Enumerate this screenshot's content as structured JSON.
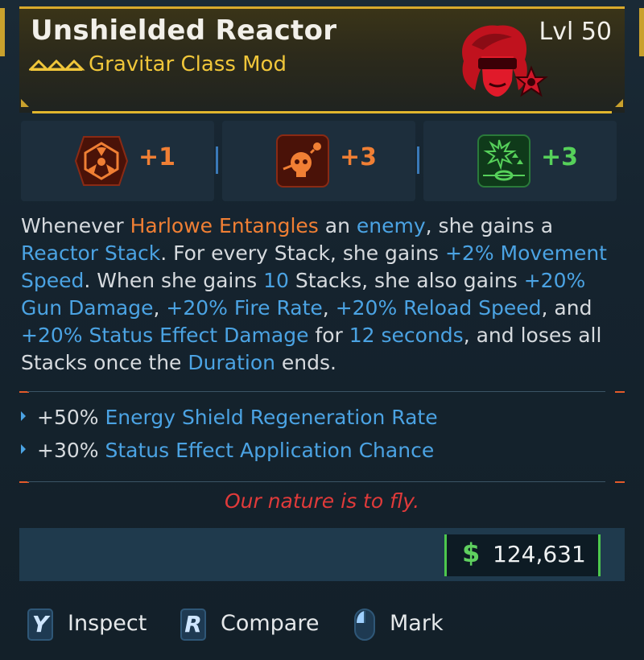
{
  "item": {
    "name": "Unshielded Reactor",
    "level": "Lvl 50",
    "class": "Gravitar Class Mod"
  },
  "skills": [
    {
      "value": "+1",
      "icon": "radiation-emblem-icon",
      "color": "#f07f34"
    },
    {
      "value": "+3",
      "icon": "skull-projectile-icon",
      "color": "#f07f34"
    },
    {
      "value": "+3",
      "icon": "burst-arrows-icon",
      "color": "#56d05a"
    }
  ],
  "description": {
    "p1": "Whenever ",
    "harlowe_entangles": "Harlowe Entangles",
    "p2": " an ",
    "enemy": "enemy",
    "p3": ", she gains a ",
    "reactor_stack": "Reactor Stack",
    "p4": ". For every Stack, she gains ",
    "plus2": "+2%",
    "p5": " ",
    "movement_speed": "Movement Speed",
    "p6": ". When she gains ",
    "ten": "10",
    "p7": " Stacks, she also gains ",
    "gun_damage": "+20% Gun Damage",
    "p8": ", ",
    "fire_rate": "+20% Fire Rate",
    "p9": ", ",
    "reload_speed": "+20% Reload Speed",
    "p10": ", and ",
    "status_damage": "+20% Status Effect Damage",
    "p11": " for ",
    "twelve_seconds": "12 seconds",
    "p12": ", and loses all Stacks once the ",
    "duration": "Duration",
    "p13": " ends."
  },
  "stats": [
    {
      "amount": "+50%",
      "name": "Energy Shield Regeneration Rate"
    },
    {
      "amount": "+30%",
      "name": "Status Effect Application Chance"
    }
  ],
  "flavor": "Our nature is to fly.",
  "price": {
    "symbol": "$",
    "value": "124,631"
  },
  "footer": [
    {
      "key": "Y",
      "label": "Inspect"
    },
    {
      "key": "R",
      "label": "Compare"
    },
    {
      "key": "",
      "label": "Mark"
    }
  ],
  "colors": {
    "gold": "#f0c63a",
    "orange": "#f07f34",
    "blue": "#4ba3e3",
    "red": "#e03a3a",
    "green": "#5fd05f"
  }
}
